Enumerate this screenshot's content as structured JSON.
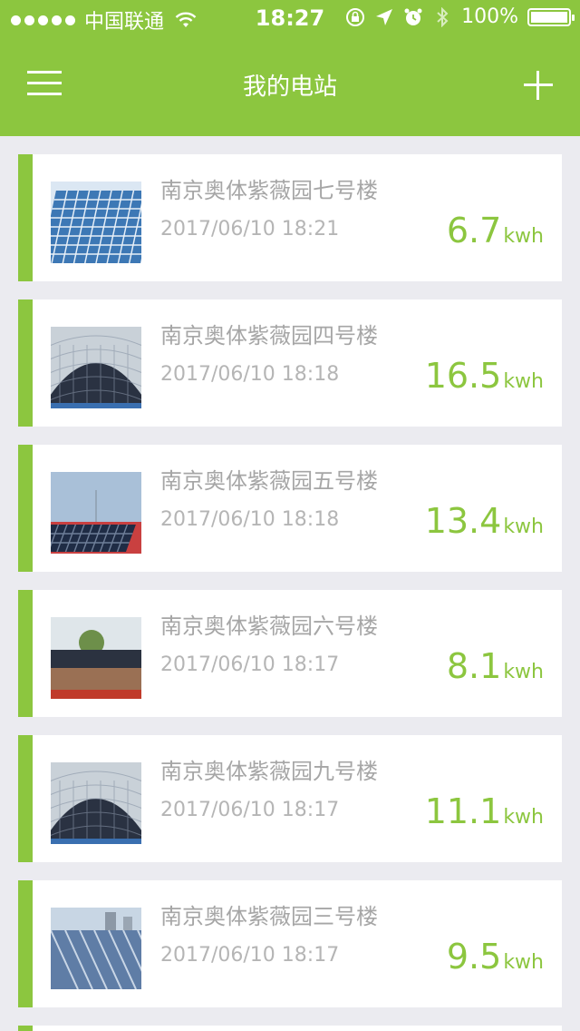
{
  "status_bar": {
    "carrier": "中国联通",
    "time": "18:27",
    "battery_percent": "100%",
    "battery_level": 1.0
  },
  "nav": {
    "title": "我的电站"
  },
  "stations": [
    {
      "name": "南京奥体紫薇园七号楼",
      "timestamp": "2017/06/10 18:21",
      "energy": "6.7",
      "unit": "kwh",
      "thumb": "solar-grid-blue"
    },
    {
      "name": "南京奥体紫薇园四号楼",
      "timestamp": "2017/06/10 18:18",
      "energy": "16.5",
      "unit": "kwh",
      "thumb": "solar-dome"
    },
    {
      "name": "南京奥体紫薇园五号楼",
      "timestamp": "2017/06/10 18:18",
      "energy": "13.4",
      "unit": "kwh",
      "thumb": "solar-roof-red"
    },
    {
      "name": "南京奥体紫薇园六号楼",
      "timestamp": "2017/06/10 18:17",
      "energy": "8.1",
      "unit": "kwh",
      "thumb": "solar-roof-tree"
    },
    {
      "name": "南京奥体紫薇园九号楼",
      "timestamp": "2017/06/10 18:17",
      "energy": "11.1",
      "unit": "kwh",
      "thumb": "solar-dome"
    },
    {
      "name": "南京奥体紫薇园三号楼",
      "timestamp": "2017/06/10 18:17",
      "energy": "9.5",
      "unit": "kwh",
      "thumb": "solar-rows-city"
    }
  ],
  "colors": {
    "accent": "#8cc63f",
    "background": "#ebebf0"
  }
}
